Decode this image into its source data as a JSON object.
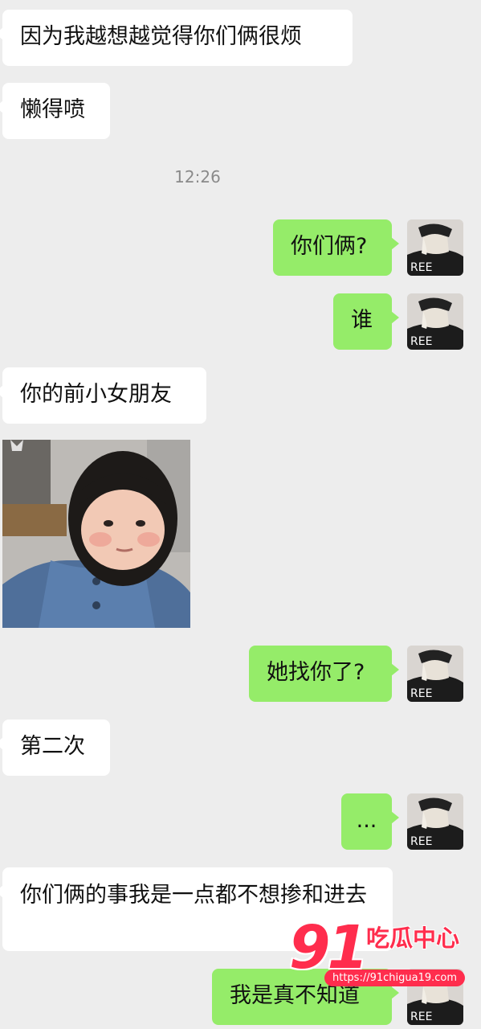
{
  "messages": {
    "m1": "因为我越想越觉得你们俩很烦",
    "m2": "懒得喷",
    "m3": "你们俩?",
    "m4": "谁",
    "m5": "你的前小女朋友",
    "m6": "她找你了?",
    "m7": "第二次",
    "m8": "...",
    "m9": "你们俩的事我是一点都不想掺和进去",
    "m10": "我是真不知道"
  },
  "timestamp": "12:26",
  "avatar": {
    "shirt_text": "REE"
  },
  "watermark": {
    "logo_number": "91",
    "brand": "吃瓜中心",
    "url": "https://91chigua19.com"
  },
  "colors": {
    "background": "#ededed",
    "incoming_bubble": "#ffffff",
    "outgoing_bubble": "#95ec69",
    "watermark_red": "#ff2d4d"
  }
}
